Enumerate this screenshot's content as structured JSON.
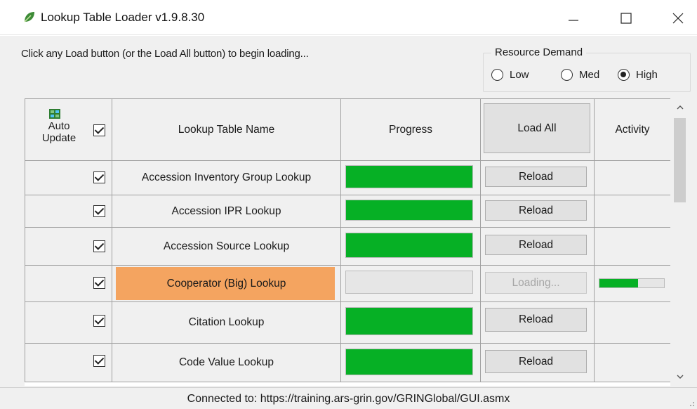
{
  "window": {
    "title": "Lookup Table Loader v1.9.8.30",
    "icon": "leaf-app-icon",
    "controls": [
      "minimize-icon",
      "maximize-icon",
      "close-icon"
    ]
  },
  "instructions": "Click any Load button (or the Load All button) to begin loading...",
  "resource_demand": {
    "title": "Resource Demand",
    "options": [
      {
        "label": "Low",
        "selected": false
      },
      {
        "label": "Med",
        "selected": false
      },
      {
        "label": "High",
        "selected": true
      }
    ]
  },
  "table": {
    "header": {
      "auto_update": "Auto Update",
      "auto_update_checked": true,
      "auto_update_icon": "refresh-grid-icon",
      "name": "Lookup Table Name",
      "progress": "Progress",
      "load_all": "Load All",
      "activity": "Activity"
    },
    "rows": [
      {
        "checked": true,
        "name": "Accession Inventory Group Lookup",
        "progress": 1.0,
        "button": "Reload",
        "button_enabled": true,
        "activity": null,
        "highlight": false
      },
      {
        "checked": true,
        "name": "Accession IPR Lookup",
        "progress": 1.0,
        "button": "Reload",
        "button_enabled": true,
        "activity": null,
        "highlight": false
      },
      {
        "checked": true,
        "name": "Accession Source Lookup",
        "progress": 1.0,
        "button": "Reload",
        "button_enabled": true,
        "activity": null,
        "highlight": false
      },
      {
        "checked": true,
        "name": "Cooperator (Big) Lookup",
        "progress": 0.0,
        "button": "Loading...",
        "button_enabled": false,
        "activity": 0.6,
        "highlight": true
      },
      {
        "checked": true,
        "name": "Citation Lookup",
        "progress": 1.0,
        "button": "Reload",
        "button_enabled": true,
        "activity": null,
        "highlight": false
      },
      {
        "checked": true,
        "name": "Code Value Lookup",
        "progress": 1.0,
        "button": "Reload",
        "button_enabled": true,
        "activity": null,
        "highlight": false
      }
    ]
  },
  "status": "Connected to: https://training.ars-grin.gov/GRINGlobal/GUI.asmx",
  "colors": {
    "progress_fill": "#06b025",
    "highlight": "#f4a460",
    "window_bg": "#f0f0f0"
  }
}
